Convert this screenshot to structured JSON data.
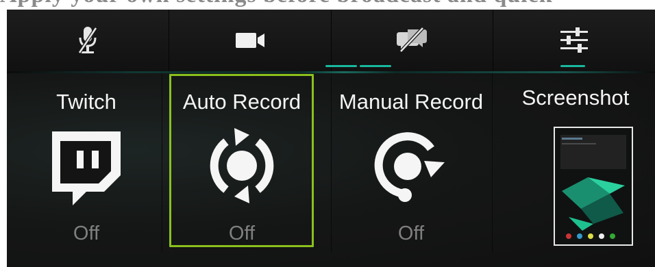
{
  "top_text": "Apply your own settings before broadcast and quick",
  "toolbar": {
    "icons": [
      "mic-off-icon",
      "video-camera-icon",
      "chat-off-icon",
      "settings-sliders-icon"
    ]
  },
  "tiles": [
    {
      "title": "Twitch",
      "status": "Off",
      "icon": "twitch-icon"
    },
    {
      "title": "Auto Record",
      "status": "Off",
      "icon": "auto-record-icon",
      "selected": true
    },
    {
      "title": "Manual Record",
      "status": "Off",
      "icon": "manual-record-icon"
    },
    {
      "title": "Screenshot",
      "status": "",
      "icon": "screenshot-thumbnail"
    }
  ],
  "colors": {
    "selection_border": "#8bc11c",
    "accent": "#18b99f",
    "background": "#141414",
    "status_text": "#7f7f7f"
  }
}
